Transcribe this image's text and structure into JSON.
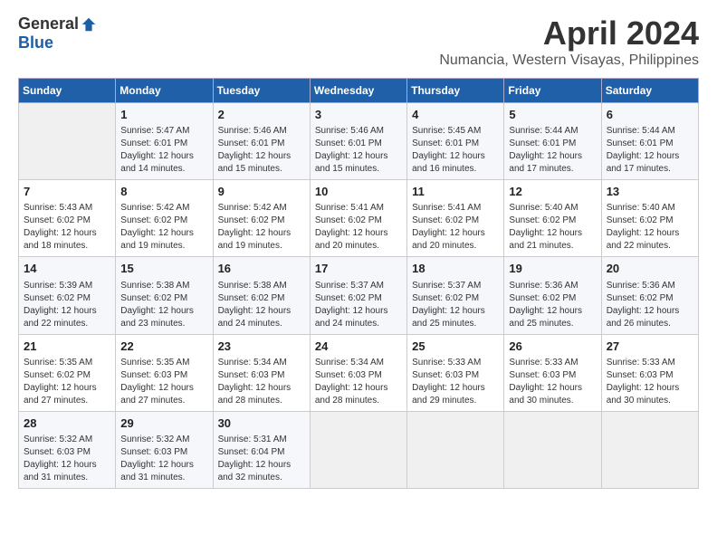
{
  "logo": {
    "general": "General",
    "blue": "Blue"
  },
  "title": "April 2024",
  "location": "Numancia, Western Visayas, Philippines",
  "headers": [
    "Sunday",
    "Monday",
    "Tuesday",
    "Wednesday",
    "Thursday",
    "Friday",
    "Saturday"
  ],
  "weeks": [
    [
      {
        "day": "",
        "info": ""
      },
      {
        "day": "1",
        "info": "Sunrise: 5:47 AM\nSunset: 6:01 PM\nDaylight: 12 hours\nand 14 minutes."
      },
      {
        "day": "2",
        "info": "Sunrise: 5:46 AM\nSunset: 6:01 PM\nDaylight: 12 hours\nand 15 minutes."
      },
      {
        "day": "3",
        "info": "Sunrise: 5:46 AM\nSunset: 6:01 PM\nDaylight: 12 hours\nand 15 minutes."
      },
      {
        "day": "4",
        "info": "Sunrise: 5:45 AM\nSunset: 6:01 PM\nDaylight: 12 hours\nand 16 minutes."
      },
      {
        "day": "5",
        "info": "Sunrise: 5:44 AM\nSunset: 6:01 PM\nDaylight: 12 hours\nand 17 minutes."
      },
      {
        "day": "6",
        "info": "Sunrise: 5:44 AM\nSunset: 6:01 PM\nDaylight: 12 hours\nand 17 minutes."
      }
    ],
    [
      {
        "day": "7",
        "info": "Sunrise: 5:43 AM\nSunset: 6:02 PM\nDaylight: 12 hours\nand 18 minutes."
      },
      {
        "day": "8",
        "info": "Sunrise: 5:42 AM\nSunset: 6:02 PM\nDaylight: 12 hours\nand 19 minutes."
      },
      {
        "day": "9",
        "info": "Sunrise: 5:42 AM\nSunset: 6:02 PM\nDaylight: 12 hours\nand 19 minutes."
      },
      {
        "day": "10",
        "info": "Sunrise: 5:41 AM\nSunset: 6:02 PM\nDaylight: 12 hours\nand 20 minutes."
      },
      {
        "day": "11",
        "info": "Sunrise: 5:41 AM\nSunset: 6:02 PM\nDaylight: 12 hours\nand 20 minutes."
      },
      {
        "day": "12",
        "info": "Sunrise: 5:40 AM\nSunset: 6:02 PM\nDaylight: 12 hours\nand 21 minutes."
      },
      {
        "day": "13",
        "info": "Sunrise: 5:40 AM\nSunset: 6:02 PM\nDaylight: 12 hours\nand 22 minutes."
      }
    ],
    [
      {
        "day": "14",
        "info": "Sunrise: 5:39 AM\nSunset: 6:02 PM\nDaylight: 12 hours\nand 22 minutes."
      },
      {
        "day": "15",
        "info": "Sunrise: 5:38 AM\nSunset: 6:02 PM\nDaylight: 12 hours\nand 23 minutes."
      },
      {
        "day": "16",
        "info": "Sunrise: 5:38 AM\nSunset: 6:02 PM\nDaylight: 12 hours\nand 24 minutes."
      },
      {
        "day": "17",
        "info": "Sunrise: 5:37 AM\nSunset: 6:02 PM\nDaylight: 12 hours\nand 24 minutes."
      },
      {
        "day": "18",
        "info": "Sunrise: 5:37 AM\nSunset: 6:02 PM\nDaylight: 12 hours\nand 25 minutes."
      },
      {
        "day": "19",
        "info": "Sunrise: 5:36 AM\nSunset: 6:02 PM\nDaylight: 12 hours\nand 25 minutes."
      },
      {
        "day": "20",
        "info": "Sunrise: 5:36 AM\nSunset: 6:02 PM\nDaylight: 12 hours\nand 26 minutes."
      }
    ],
    [
      {
        "day": "21",
        "info": "Sunrise: 5:35 AM\nSunset: 6:02 PM\nDaylight: 12 hours\nand 27 minutes."
      },
      {
        "day": "22",
        "info": "Sunrise: 5:35 AM\nSunset: 6:03 PM\nDaylight: 12 hours\nand 27 minutes."
      },
      {
        "day": "23",
        "info": "Sunrise: 5:34 AM\nSunset: 6:03 PM\nDaylight: 12 hours\nand 28 minutes."
      },
      {
        "day": "24",
        "info": "Sunrise: 5:34 AM\nSunset: 6:03 PM\nDaylight: 12 hours\nand 28 minutes."
      },
      {
        "day": "25",
        "info": "Sunrise: 5:33 AM\nSunset: 6:03 PM\nDaylight: 12 hours\nand 29 minutes."
      },
      {
        "day": "26",
        "info": "Sunrise: 5:33 AM\nSunset: 6:03 PM\nDaylight: 12 hours\nand 30 minutes."
      },
      {
        "day": "27",
        "info": "Sunrise: 5:33 AM\nSunset: 6:03 PM\nDaylight: 12 hours\nand 30 minutes."
      }
    ],
    [
      {
        "day": "28",
        "info": "Sunrise: 5:32 AM\nSunset: 6:03 PM\nDaylight: 12 hours\nand 31 minutes."
      },
      {
        "day": "29",
        "info": "Sunrise: 5:32 AM\nSunset: 6:03 PM\nDaylight: 12 hours\nand 31 minutes."
      },
      {
        "day": "30",
        "info": "Sunrise: 5:31 AM\nSunset: 6:04 PM\nDaylight: 12 hours\nand 32 minutes."
      },
      {
        "day": "",
        "info": ""
      },
      {
        "day": "",
        "info": ""
      },
      {
        "day": "",
        "info": ""
      },
      {
        "day": "",
        "info": ""
      }
    ]
  ]
}
